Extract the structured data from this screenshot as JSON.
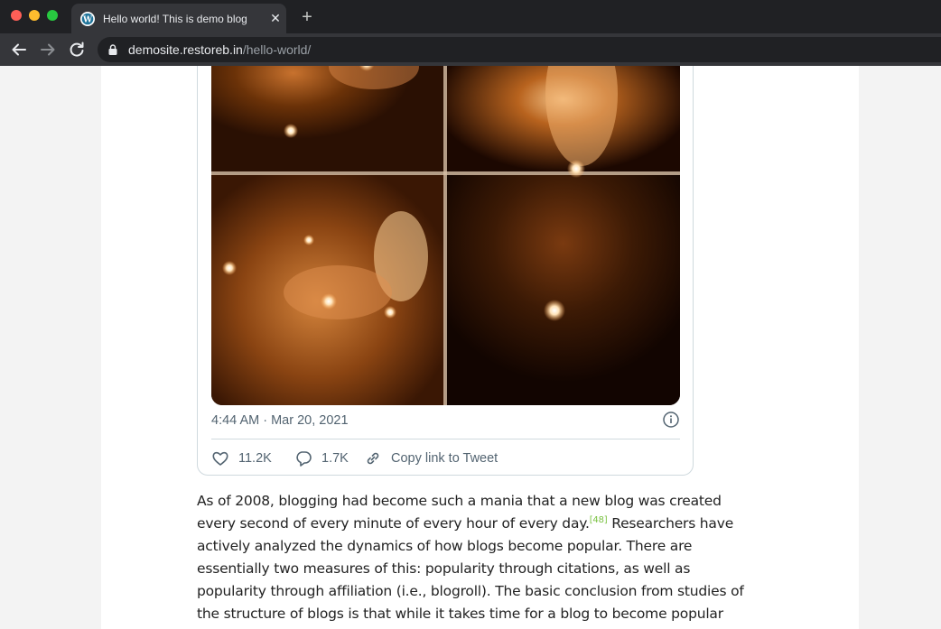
{
  "browser": {
    "tab_title": "Hello world! This is demo blog",
    "tab_close": "✕",
    "new_tab": "+",
    "url_host": "demosite.restoreb.in",
    "url_path": "/hello-world/"
  },
  "tweet": {
    "timestamp": "4:44 AM · Mar 20, 2021",
    "like_count": "11.2K",
    "reply_count": "1.7K",
    "copy_link_label": "Copy link to Tweet"
  },
  "article": {
    "p1_a": "As of 2008, blogging had become such a mania that a new blog was created every second of every minute of every hour of every day.",
    "citation": "[48]",
    "p1_b": " Researchers have actively analyzed the dynamics of how blogs become popular. There are essentially two measures of this: popularity through citations, as well as popularity through affiliation (i.e., blogroll). The basic conclusion from studies of the structure of blogs is that while it takes time for a blog to become popular through"
  },
  "colors": {
    "chrome_dark": "#202124",
    "chrome_tab": "#35363a",
    "citation_green": "#7ac142",
    "tweet_gray": "#536471"
  }
}
